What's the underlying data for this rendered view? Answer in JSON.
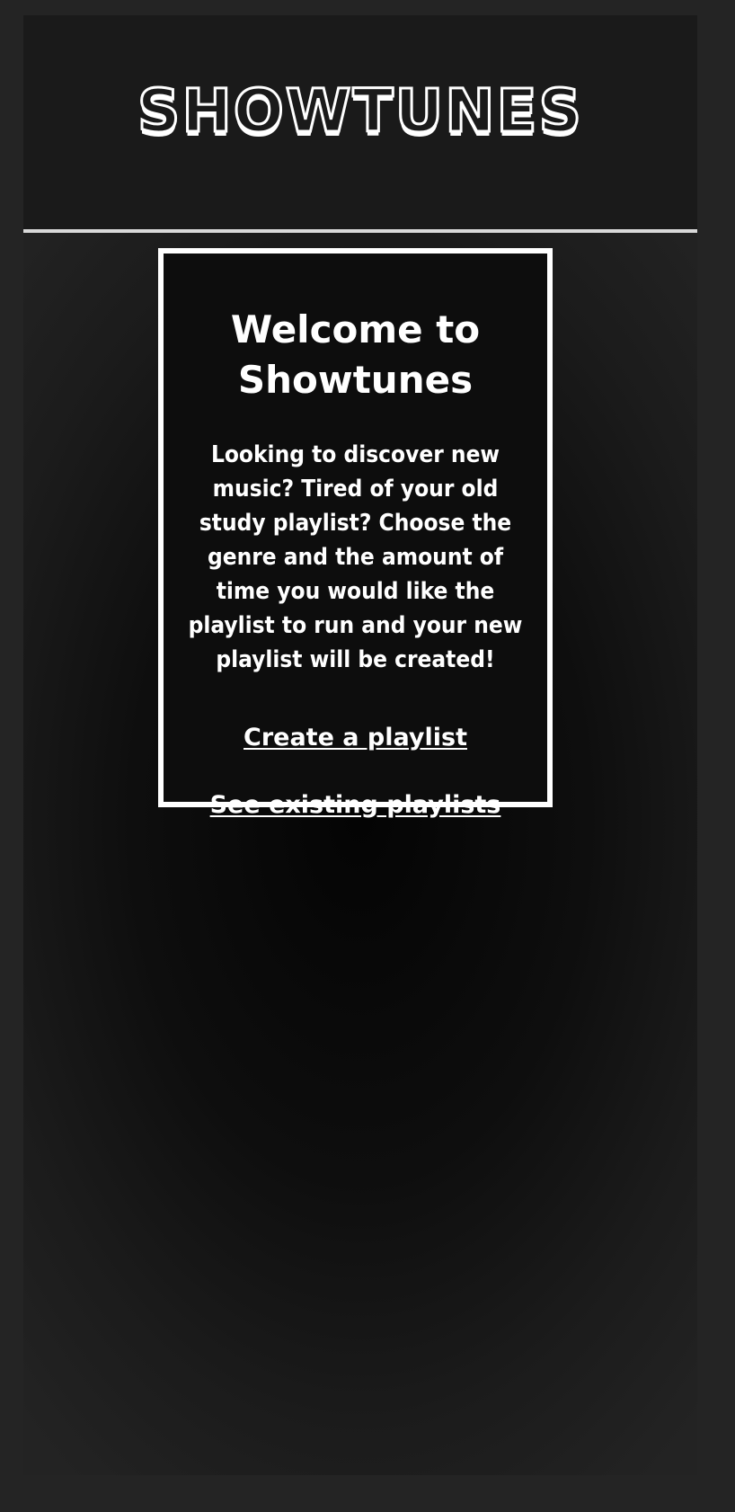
{
  "header": {
    "logo_text": "SHOWTUNES"
  },
  "welcome": {
    "title": "Welcome to Showtunes",
    "description": "Looking to discover new music? Tired of your old study playlist? Choose the genre and the amount of time you would like the playlist to run and your new playlist will be created!",
    "create_link_label": "Create a playlist",
    "existing_link_label": "See existing playlists"
  },
  "colors": {
    "page_background": "#242424",
    "header_background": "#1a1a1a",
    "card_background": "#0d0d0d",
    "text": "#ffffff",
    "divider": "#d9d9d9"
  }
}
